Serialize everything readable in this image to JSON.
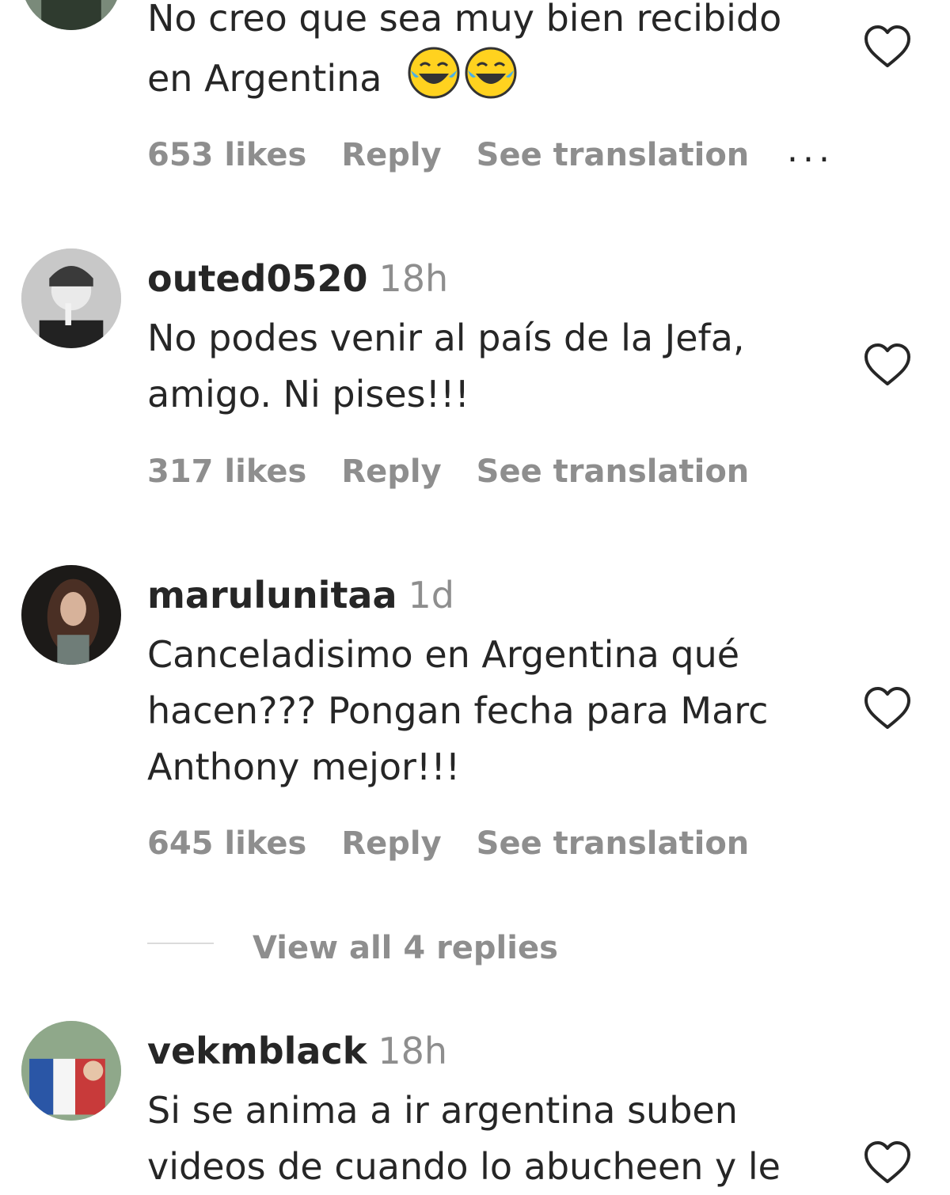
{
  "comments": [
    {
      "username": "",
      "time": "",
      "text_lines": [
        "No creo que sea muy bien recibido",
        "en Argentina"
      ],
      "emoji": [
        "face-with-tears-of-joy",
        "face-with-tears-of-joy"
      ],
      "likes": "653 likes",
      "reply": "Reply",
      "translate": "See translation",
      "more": "..."
    },
    {
      "username": "outed0520",
      "time": "18h",
      "text_lines": [
        "No podes venir al país de la Jefa,",
        "amigo. Ni pises!!!"
      ],
      "likes": "317 likes",
      "reply": "Reply",
      "translate": "See translation"
    },
    {
      "username": "marulunitaa",
      "time": "1d",
      "text_lines": [
        "Canceladisimo en Argentina qué",
        "hacen??? Pongan fecha para Marc",
        "Anthony mejor!!!"
      ],
      "likes": "645 likes",
      "reply": "Reply",
      "translate": "See translation",
      "view_replies": "View all 4 replies"
    },
    {
      "username": "vekmblack",
      "time": "18h",
      "text_lines": [
        "Si se anima a ir argentina suben",
        "videos de cuando lo abucheen y le"
      ]
    }
  ],
  "colors": {
    "text": "#262626",
    "secondary": "#8e8e8e",
    "divider": "#dbdbdb",
    "background": "#ffffff"
  },
  "icons": {
    "like": "heart-outline-icon",
    "more": "ellipsis-icon"
  }
}
